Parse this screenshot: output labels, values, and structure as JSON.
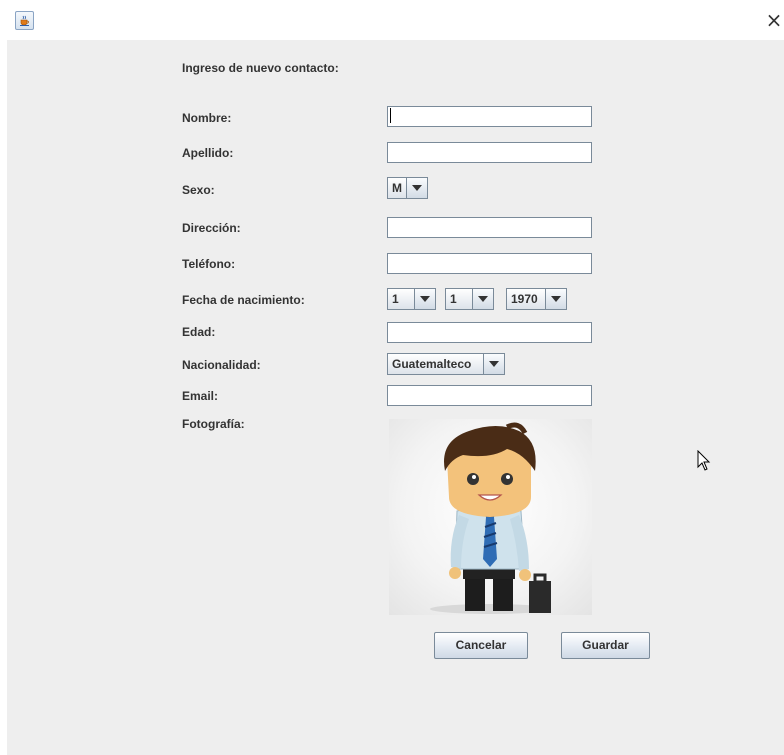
{
  "window": {
    "close_symbol": "×"
  },
  "form": {
    "heading": "Ingreso de nuevo contacto:",
    "labels": {
      "nombre": "Nombre:",
      "apellido": "Apellido:",
      "sexo": "Sexo:",
      "direccion": "Dirección:",
      "telefono": "Teléfono:",
      "fecha": "Fecha de nacimiento:",
      "edad": "Edad:",
      "nacionalidad": "Nacionalidad:",
      "email": "Email:",
      "fotografia": "Fotografía:"
    },
    "values": {
      "nombre": "",
      "apellido": "",
      "direccion": "",
      "telefono": "",
      "edad": "",
      "email": ""
    },
    "selects": {
      "sexo": "M",
      "dia": "1",
      "mes": "1",
      "anio": "1970",
      "nacionalidad": "Guatemalteco"
    },
    "buttons": {
      "cancel": "Cancelar",
      "save": "Guardar"
    }
  },
  "icons": {
    "app": "java-cup-icon",
    "close": "close-icon",
    "dropdown": "chevron-down-icon",
    "cursor": "mouse-pointer-icon"
  },
  "colors": {
    "panel_bg": "#eeeeee",
    "field_border": "#7a8a99",
    "label_text": "#333333"
  }
}
